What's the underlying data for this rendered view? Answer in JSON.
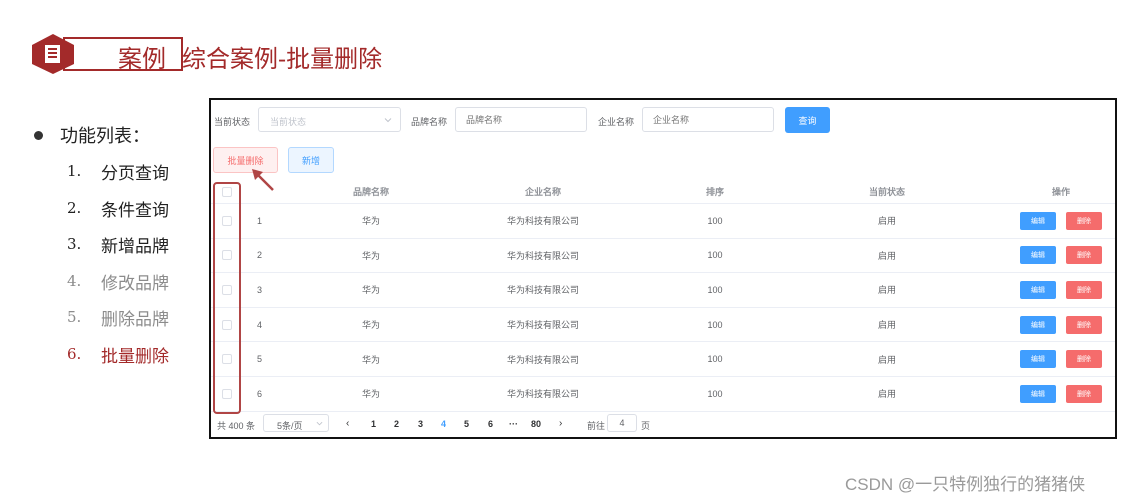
{
  "slide": {
    "badge_text": "案例",
    "title": "综合案例-批量删除",
    "feature_heading": "功能列表：",
    "features": [
      {
        "num": "1.",
        "label": "分页查询"
      },
      {
        "num": "2.",
        "label": "条件查询"
      },
      {
        "num": "3.",
        "label": "新增品牌"
      },
      {
        "num": "4.",
        "label": "修改品牌"
      },
      {
        "num": "5.",
        "label": "删除品牌"
      },
      {
        "num": "6.",
        "label": "批量删除"
      }
    ],
    "watermark": "CSDN @一只特例独行的猪猪侠",
    "colors": {
      "accent": "#a32a2a",
      "primary": "#409eff",
      "danger": "#f56c6c"
    }
  },
  "search": {
    "status_label": "当前状态",
    "status_placeholder": "当前状态",
    "brand_label": "品牌名称",
    "brand_placeholder": "品牌名称",
    "company_label": "企业名称",
    "company_placeholder": "企业名称",
    "query_button": "查询"
  },
  "toolbar": {
    "batch_delete": "批量删除",
    "add": "新增"
  },
  "table": {
    "headers": {
      "brand": "品牌名称",
      "company": "企业名称",
      "order": "排序",
      "status": "当前状态",
      "ops": "操作"
    },
    "edit_label": "编辑",
    "delete_label": "删除",
    "rows": [
      {
        "idx": "1",
        "brand": "华为",
        "company": "华为科技有限公司",
        "order": "100",
        "status": "启用"
      },
      {
        "idx": "2",
        "brand": "华为",
        "company": "华为科技有限公司",
        "order": "100",
        "status": "启用"
      },
      {
        "idx": "3",
        "brand": "华为",
        "company": "华为科技有限公司",
        "order": "100",
        "status": "启用"
      },
      {
        "idx": "4",
        "brand": "华为",
        "company": "华为科技有限公司",
        "order": "100",
        "status": "启用"
      },
      {
        "idx": "5",
        "brand": "华为",
        "company": "华为科技有限公司",
        "order": "100",
        "status": "启用"
      },
      {
        "idx": "6",
        "brand": "华为",
        "company": "华为科技有限公司",
        "order": "100",
        "status": "启用"
      }
    ]
  },
  "pagination": {
    "total": "共 400 条",
    "page_size": "5条/页",
    "prev": "‹",
    "pages": [
      "1",
      "2",
      "3",
      "4",
      "5",
      "6"
    ],
    "current": "4",
    "ellipsis": "···",
    "last": "80",
    "next": "›",
    "goto_label": "前往",
    "goto_value": "4",
    "page_suffix": "页"
  }
}
